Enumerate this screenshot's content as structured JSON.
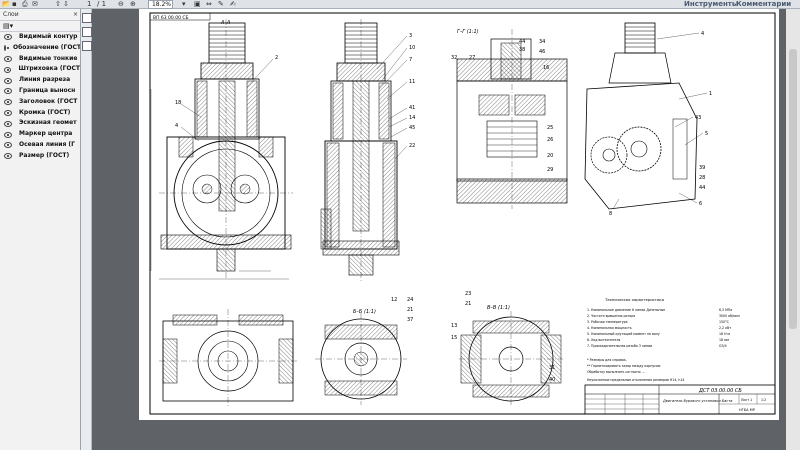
{
  "toolbar": {
    "page_current": "1",
    "page_total": "/ 1",
    "zoom": "18.2%",
    "tools_label": "Инструменты",
    "comments_label": "Комментарии"
  },
  "sidebar": {
    "title": "Слои",
    "close": "×",
    "options_icon": "▤▾",
    "layers": [
      {
        "label": "Видимый контур"
      },
      {
        "label": "Обозначение (ГОСТ"
      },
      {
        "label": "Видимые тонкие"
      },
      {
        "label": "Штриховка (ГОСТ"
      },
      {
        "label": "Линия разреза"
      },
      {
        "label": "Граница выносн"
      },
      {
        "label": "Заголовок (ГОСТ"
      },
      {
        "label": "Кромка (ГОСТ)"
      },
      {
        "label": "Эскизная геомет"
      },
      {
        "label": "Маркер центра"
      },
      {
        "label": "Осевая линия (Г"
      },
      {
        "label": "Размер (ГОСТ)"
      }
    ]
  },
  "drawing": {
    "doc_number_rot": "ВП 63 00.00 СБ",
    "section_aa": "А–А",
    "section_gg": "Г–Г (1:1)",
    "section_bb": "Б–Б (1:1)",
    "section_vv": "В–В (1:1)",
    "tech_title": "Техническая характеристика",
    "tech_lines": [
      "1. Номинальное давление 6 линии Дизельные",
      "2. Частота вращения ротора",
      "3. Рабочая температура",
      "4. Номинальная мощность",
      "5. Номинальный крутящий момент на валу",
      "6. Ход вытеснителя",
      "7. Присоединительная резьба 3 линии"
    ],
    "tech_values": [
      "6,3 МПа",
      "3000 об/мин",
      "150°C",
      "2,2 кВт",
      "16 Н·м",
      "18 мм",
      "G3/4"
    ],
    "notes": [
      "* Размеры для справок.",
      "** Герметизировать зазор между корпусом",
      "Обработку выполнить согласно ...",
      "Неуказанные предельные отклонения размеров Н14, h14"
    ],
    "title_doc": "ДСТ 03.00.00 СБ",
    "title_name": "Двигатель бурового установки Баста",
    "title_org": "НГБА МР",
    "title_sheet": "Лист 1",
    "title_scale": "1:2",
    "callouts": {
      "c2": "2",
      "c18": "18",
      "c4": "4",
      "c3": "3",
      "c10": "10",
      "c7": "7",
      "c11": "11",
      "c41": "41",
      "c14": "14",
      "c45": "45",
      "c22": "22",
      "c32": "32",
      "c27": "27",
      "c44": "44",
      "c38": "38",
      "c34": "34",
      "c46": "46",
      "c16": "16",
      "c25": "25",
      "c26": "26",
      "c20": "20",
      "c29": "29",
      "c43": "43",
      "c5": "5",
      "c39": "39",
      "c28": "28",
      "c6": "6",
      "c8": "8",
      "c1": "1",
      "c24": "24",
      "c37": "37",
      "c12": "12",
      "c23": "23",
      "c13": "13",
      "c15": "15",
      "c31": "31",
      "c40": "40",
      "c21": "21"
    }
  }
}
